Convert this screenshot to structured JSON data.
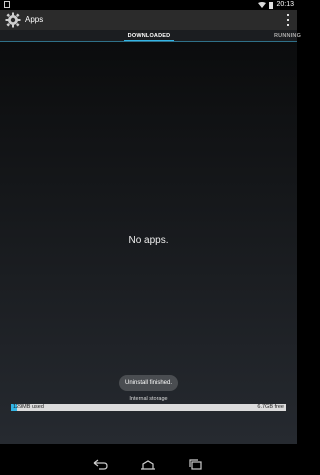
{
  "status_bar": {
    "time": "20:13",
    "icons": [
      "notification-icon",
      "wifi-icon",
      "battery-icon"
    ]
  },
  "action_bar": {
    "title": "Apps",
    "icons": [
      "settings-icon",
      "overflow-menu-icon"
    ]
  },
  "tabs": [
    {
      "label": "DOWNLOADED",
      "active": true
    },
    {
      "label": "RUNNING",
      "active": false
    }
  ],
  "content": {
    "empty_message": "No apps."
  },
  "toast": {
    "message": "Uninstall finished."
  },
  "storage": {
    "label": "Internal storage",
    "used": "129MB used",
    "free": "6.7GB free",
    "used_fraction": 0.02
  },
  "nav_bar": {
    "icons": [
      "back-icon",
      "home-icon",
      "recents-icon"
    ]
  },
  "colors": {
    "accent": "#33b5e5",
    "action_bar_bg": "#2b2b2b",
    "toast_bg": "#4a4d51"
  }
}
